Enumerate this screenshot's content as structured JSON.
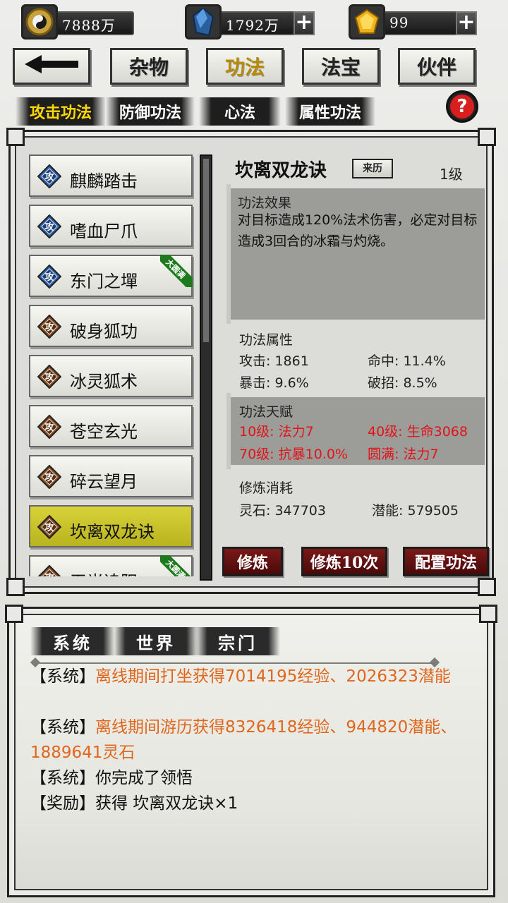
{
  "currencies": [
    {
      "icon": "yin-yang-coin-icon",
      "value": "7888万",
      "has_plus": false
    },
    {
      "icon": "blue-crystal-icon",
      "value": "1792万",
      "has_plus": true
    },
    {
      "icon": "gold-gem-icon",
      "value": "99",
      "has_plus": true
    }
  ],
  "nav": {
    "back_icon": "back-arrow-icon",
    "items": [
      "杂物",
      "功法",
      "法宝",
      "伙伴"
    ],
    "active": "功法"
  },
  "subtabs": {
    "items": [
      "攻击功法",
      "防御功法",
      "心法",
      "属性功法"
    ],
    "active": "攻击功法",
    "help": "?"
  },
  "skills": [
    {
      "name": "麒麟踏击",
      "badge": "攻",
      "badge_style": "blue",
      "tag": ""
    },
    {
      "name": "嗜血尸爪",
      "badge": "攻",
      "badge_style": "blue",
      "tag": ""
    },
    {
      "name": "东门之墠",
      "badge": "攻",
      "badge_style": "blue",
      "tag": "大圆满"
    },
    {
      "name": "破身狐功",
      "badge": "攻",
      "badge_style": "brown",
      "tag": ""
    },
    {
      "name": "冰灵狐术",
      "badge": "攻",
      "badge_style": "brown",
      "tag": ""
    },
    {
      "name": "苍空玄光",
      "badge": "攻",
      "badge_style": "brown",
      "tag": ""
    },
    {
      "name": "碎云望月",
      "badge": "攻",
      "badge_style": "brown",
      "tag": ""
    },
    {
      "name": "坎离双龙诀",
      "badge": "攻",
      "badge_style": "brown",
      "tag": "",
      "selected": true
    },
    {
      "name": "天光追阳",
      "badge": "攻",
      "badge_style": "brown",
      "tag": "大圆满"
    }
  ],
  "detail": {
    "title": "坎离双龙诀",
    "origin_button": "来历",
    "level": "1级",
    "effect_header": "功法效果",
    "effect_text": "对目标造成120%法术伤害，必定对目标造成3回合的冰霜与灼烧。",
    "attr_header": "功法属性",
    "attrs": [
      {
        "label": "攻击:",
        "value": "1861"
      },
      {
        "label": "命中:",
        "value": "11.4%"
      },
      {
        "label": "暴击:",
        "value": "9.6%"
      },
      {
        "label": "破招:",
        "value": "8.5%"
      }
    ],
    "talent_header": "功法天赋",
    "talents": [
      "10级: 法力7",
      "40级: 生命3068",
      "70级: 抗暴10.0%",
      "圆满: 法力7"
    ],
    "cost_header": "修炼消耗",
    "costs": [
      {
        "label": "灵石:",
        "value": "347703"
      },
      {
        "label": "潜能:",
        "value": "579505"
      }
    ],
    "buttons": [
      "修炼",
      "修炼10次",
      "配置功法"
    ]
  },
  "chat": {
    "tabs": [
      "系统",
      "世界",
      "宗门"
    ],
    "messages": [
      {
        "prefix": "【系统】",
        "text": "离线期间打坐获得7014195经验、2026323潜能",
        "highlight": true
      },
      {
        "prefix": "【系统】",
        "text": "离线期间游历获得8326418经验、944820潜能、1889641灵石",
        "highlight": true
      },
      {
        "prefix": "【系统】",
        "text": "你完成了领悟",
        "highlight": false
      },
      {
        "prefix": "【奖励】",
        "text": "获得 坎离双龙诀×1",
        "highlight": false
      }
    ]
  },
  "colors": {
    "accent_yellow": "#ffd800",
    "talent_red": "#e0151b",
    "message_orange": "#e0661c",
    "selected_item": "#c8c22a"
  }
}
